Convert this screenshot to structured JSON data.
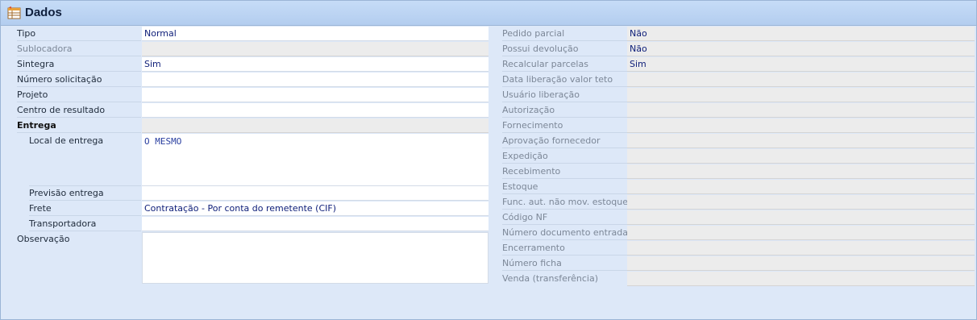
{
  "header": {
    "title": "Dados",
    "icon": "table-form-icon"
  },
  "left": {
    "tipo": {
      "label": "Tipo",
      "value": "Normal"
    },
    "sublocadora": {
      "label": "Sublocadora",
      "value": ""
    },
    "sintegra": {
      "label": "Sintegra",
      "value": "Sim"
    },
    "numero_solicitacao": {
      "label": "Número solicitação",
      "value": ""
    },
    "projeto": {
      "label": "Projeto",
      "value": ""
    },
    "centro_resultado": {
      "label": "Centro de resultado",
      "value": ""
    },
    "entrega": {
      "label": "Entrega"
    },
    "local_entrega": {
      "label": "Local de entrega",
      "value": "O MESMO"
    },
    "previsao_entrega": {
      "label": "Previsão entrega",
      "value": ""
    },
    "frete": {
      "label": "Frete",
      "value": "Contratação - Por conta do remetente (CIF)"
    },
    "transportadora": {
      "label": "Transportadora",
      "value": ""
    },
    "observacao": {
      "label": "Observação",
      "value": ""
    }
  },
  "right": {
    "pedido_parcial": {
      "label": "Pedido parcial",
      "value": "Não"
    },
    "possui_devolucao": {
      "label": "Possui devolução",
      "value": "Não"
    },
    "recalcular_parcelas": {
      "label": "Recalcular parcelas",
      "value": "Sim"
    },
    "data_liberacao_valor_teto": {
      "label": "Data liberação valor teto",
      "value": ""
    },
    "usuario_liberacao": {
      "label": "Usuário liberação",
      "value": ""
    },
    "autorizacao": {
      "label": "Autorização",
      "value": ""
    },
    "fornecimento": {
      "label": "Fornecimento",
      "value": ""
    },
    "aprovacao_fornecedor": {
      "label": "Aprovação fornecedor",
      "value": ""
    },
    "expedicao": {
      "label": "Expedição",
      "value": ""
    },
    "recebimento": {
      "label": "Recebimento",
      "value": ""
    },
    "estoque": {
      "label": "Estoque",
      "value": ""
    },
    "func_aut_nao_mov_estoque": {
      "label": "Func. aut. não mov. estoque",
      "value": ""
    },
    "codigo_nf": {
      "label": "Código NF",
      "value": ""
    },
    "numero_documento_entrada": {
      "label": "Número documento entrada",
      "value": ""
    },
    "encerramento": {
      "label": "Encerramento",
      "value": ""
    },
    "numero_ficha": {
      "label": "Número ficha",
      "value": ""
    },
    "venda_transferencia": {
      "label": "Venda (transferência)",
      "value": ""
    }
  }
}
